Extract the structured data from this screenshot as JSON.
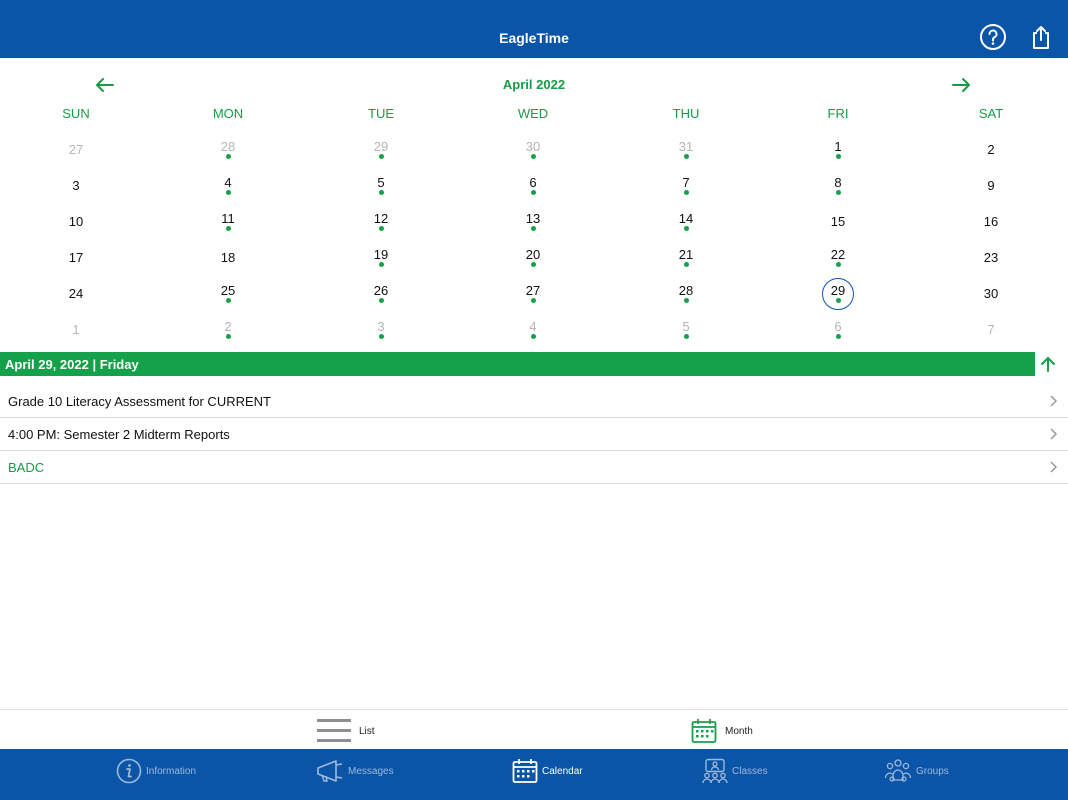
{
  "header": {
    "title": "EagleTime"
  },
  "calendar": {
    "month_title": "April 2022",
    "weekdays": [
      "SUN",
      "MON",
      "TUE",
      "WED",
      "THU",
      "FRI",
      "SAT"
    ],
    "weeks": [
      [
        {
          "d": "27",
          "m": true,
          "e": false
        },
        {
          "d": "28",
          "m": true,
          "e": true
        },
        {
          "d": "29",
          "m": true,
          "e": true
        },
        {
          "d": "30",
          "m": true,
          "e": true
        },
        {
          "d": "31",
          "m": true,
          "e": true
        },
        {
          "d": "1",
          "m": false,
          "e": true
        },
        {
          "d": "2",
          "m": false,
          "e": false
        }
      ],
      [
        {
          "d": "3",
          "m": false,
          "e": false
        },
        {
          "d": "4",
          "m": false,
          "e": true
        },
        {
          "d": "5",
          "m": false,
          "e": true
        },
        {
          "d": "6",
          "m": false,
          "e": true
        },
        {
          "d": "7",
          "m": false,
          "e": true
        },
        {
          "d": "8",
          "m": false,
          "e": true
        },
        {
          "d": "9",
          "m": false,
          "e": false
        }
      ],
      [
        {
          "d": "10",
          "m": false,
          "e": false
        },
        {
          "d": "11",
          "m": false,
          "e": true
        },
        {
          "d": "12",
          "m": false,
          "e": true
        },
        {
          "d": "13",
          "m": false,
          "e": true
        },
        {
          "d": "14",
          "m": false,
          "e": true
        },
        {
          "d": "15",
          "m": false,
          "e": false
        },
        {
          "d": "16",
          "m": false,
          "e": false
        }
      ],
      [
        {
          "d": "17",
          "m": false,
          "e": false
        },
        {
          "d": "18",
          "m": false,
          "e": false
        },
        {
          "d": "19",
          "m": false,
          "e": true
        },
        {
          "d": "20",
          "m": false,
          "e": true
        },
        {
          "d": "21",
          "m": false,
          "e": true
        },
        {
          "d": "22",
          "m": false,
          "e": true
        },
        {
          "d": "23",
          "m": false,
          "e": false
        }
      ],
      [
        {
          "d": "24",
          "m": false,
          "e": false
        },
        {
          "d": "25",
          "m": false,
          "e": true
        },
        {
          "d": "26",
          "m": false,
          "e": true
        },
        {
          "d": "27",
          "m": false,
          "e": true
        },
        {
          "d": "28",
          "m": false,
          "e": true
        },
        {
          "d": "29",
          "m": false,
          "e": true,
          "selected": true
        },
        {
          "d": "30",
          "m": false,
          "e": false
        }
      ],
      [
        {
          "d": "1",
          "m": true,
          "e": false
        },
        {
          "d": "2",
          "m": true,
          "e": true
        },
        {
          "d": "3",
          "m": true,
          "e": true
        },
        {
          "d": "4",
          "m": true,
          "e": true
        },
        {
          "d": "5",
          "m": true,
          "e": true
        },
        {
          "d": "6",
          "m": true,
          "e": true
        },
        {
          "d": "7",
          "m": true,
          "e": false
        }
      ]
    ]
  },
  "selected_date": {
    "label": "April 29, 2022 | Friday"
  },
  "events": [
    {
      "text": "Grade 10 Literacy Assessment for CURRENT",
      "color": "default"
    },
    {
      "text": "4:00 PM: Semester 2 Midterm Reports",
      "color": "default"
    },
    {
      "text": "BADC",
      "color": "green"
    }
  ],
  "view_switch": {
    "list_label": "List",
    "month_label": "Month",
    "active": "Month"
  },
  "tabs": [
    {
      "label": "Information",
      "icon": "info-icon",
      "active": false
    },
    {
      "label": "Messages",
      "icon": "megaphone-icon",
      "active": false
    },
    {
      "label": "Calendar",
      "icon": "calendar-icon",
      "active": true
    },
    {
      "label": "Classes",
      "icon": "classes-icon",
      "active": false
    },
    {
      "label": "Groups",
      "icon": "groups-icon",
      "active": false
    }
  ],
  "colors": {
    "brand_blue": "#0a55a8",
    "accent_green": "#15a04a",
    "muted_text": "#b4b4b4",
    "tab_inactive": "#9fb9db"
  }
}
